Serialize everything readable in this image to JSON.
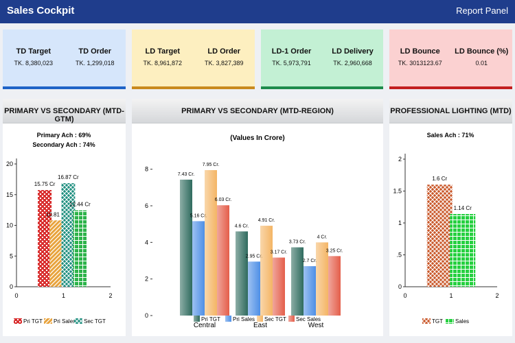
{
  "header": {
    "title": "Sales Cockpit",
    "panel_link": "Report Panel"
  },
  "kpis": [
    {
      "left_label": "TD Target",
      "left_value": "TK. 8,380,023",
      "right_label": "TD Order",
      "right_value": "TK. 1,299,018",
      "bg": "#d6e6fb",
      "border": "#1f63c7"
    },
    {
      "left_label": "LD Target",
      "left_value": "TK. 8,961,872",
      "right_label": "LD Order",
      "right_value": "TK. 3,827,389",
      "bg": "#fdefc0",
      "border": "#c98a1e"
    },
    {
      "left_label": "LD-1 Order",
      "left_value": "TK. 5,973,791",
      "right_label": "LD Delivery",
      "right_value": "TK. 2,960,668",
      "bg": "#c3f0d4",
      "border": "#1e8b4c"
    },
    {
      "left_label": "LD Bounce",
      "left_value": "TK. 3013123.67",
      "right_label": "LD Bounce (%)",
      "right_value": "0.01",
      "bg": "#fbd1d1",
      "border": "#c31f1f"
    }
  ],
  "panels": {
    "gtm": {
      "title": "PRIMARY VS SECONDARY (MTD-GTM)"
    },
    "region": {
      "title": "PRIMARY VS SECONDARY (MTD-REGION)"
    },
    "lighting": {
      "title": "PROFESSIONAL LIGHTING (MTD)"
    }
  },
  "chart_data": [
    {
      "type": "bar",
      "title": "Primary Ach : 69%",
      "subtitle": "Secondary Ach : 74%",
      "xlim": [
        0,
        2
      ],
      "ylim": [
        0,
        20
      ],
      "x_ticks": [
        "0",
        "1",
        "2"
      ],
      "y_ticks": [
        "0",
        "5",
        "10",
        "15",
        "20"
      ],
      "grid": false,
      "legend_position": "bottom",
      "series": [
        {
          "name": "Pri TGT",
          "x": 0.6,
          "value": 15.75,
          "label": "15.75 Cr",
          "color": "#d93030",
          "pattern": "checker"
        },
        {
          "name": "Pri Sales",
          "x": 0.85,
          "value": 10.81,
          "label": "10.81 Cr",
          "color": "#e8a33d",
          "pattern": "diagonal"
        },
        {
          "name": "Sec TGT",
          "x": 1.1,
          "value": 16.87,
          "label": "16.87 Cr",
          "color": "#1f8f7f",
          "pattern": "weave"
        },
        {
          "name": "",
          "x": 1.35,
          "value": 12.44,
          "label": "12.44 Cr",
          "color": "#2db34a",
          "pattern": "grid"
        }
      ]
    },
    {
      "type": "bar",
      "title": "(Values In Crore)",
      "categories": [
        "Central",
        "East",
        "West"
      ],
      "ylim": [
        0,
        9
      ],
      "y_ticks": [
        "0",
        "2",
        "4",
        "6",
        "8"
      ],
      "grid": false,
      "legend_position": "bottom",
      "series": [
        {
          "name": "Pri TGT",
          "values": [
            7.43,
            4.6,
            3.73
          ],
          "labels": [
            "7.43 Cr.",
            "4.6 Cr.",
            "3.73 Cr."
          ],
          "color": "#2f6b5e"
        },
        {
          "name": "Pri Sales",
          "values": [
            5.16,
            2.95,
            2.7
          ],
          "labels": [
            "5.16 Cr.",
            "2.95 Cr.",
            "2.7 Cr."
          ],
          "color": "#4e8fe6"
        },
        {
          "name": "Sec TGT",
          "values": [
            7.95,
            4.91,
            4.0
          ],
          "labels": [
            "7.95 Cr.",
            "4.91 Cr.",
            "4 Cr."
          ],
          "color": "#f4b565"
        },
        {
          "name": "Sec Sales",
          "values": [
            6.03,
            3.17,
            3.25
          ],
          "labels": [
            "6.03 Cr.",
            "3.17 Cr.",
            "3.25 Cr."
          ],
          "color": "#e45e4a"
        }
      ]
    },
    {
      "type": "bar",
      "title": "Sales Ach : 71%",
      "xlim": [
        0,
        2
      ],
      "ylim": [
        0,
        2
      ],
      "x_ticks": [
        "0",
        "1",
        "2"
      ],
      "y_ticks": [
        "0",
        ".5",
        "1",
        "1.5",
        "2"
      ],
      "grid": false,
      "legend_position": "bottom",
      "series": [
        {
          "name": "TGT",
          "x": 0.75,
          "value": 1.6,
          "label": "1.6 Cr",
          "color": "#c9582a",
          "pattern": "weave"
        },
        {
          "name": "Sales",
          "x": 1.25,
          "value": 1.14,
          "label": "1.14 Cr",
          "color": "#26d040",
          "pattern": "grid"
        }
      ]
    }
  ]
}
